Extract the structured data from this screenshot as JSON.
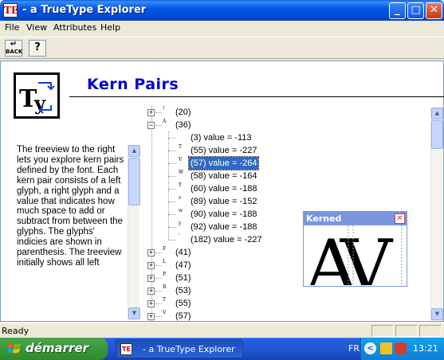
{
  "window": {
    "title": "- a TrueType Explorer",
    "icon_text": "TE",
    "minimize_label": "_",
    "maximize_label": "□",
    "close_label": "✕"
  },
  "menu": [
    "File",
    "View",
    "Attributes",
    "Help"
  ],
  "toolbar": {
    "back_label": "BACK",
    "help_label": "?"
  },
  "content": {
    "page_title": "Kern Pairs",
    "description": "The treeview to the right lets you explore kern pairs defined by the font. Each kern pair consists of a left glyph, a right glyph and a value that indicates how much space to add or subtract from between the glyphs. The glyphs' indicies are shown in parenthesis. The treeview initially shows all left"
  },
  "tree": {
    "collapsed_top": {
      "glyph": "!",
      "label": "(20)"
    },
    "expanded": {
      "glyph": "A",
      "label": "(36)"
    },
    "children": [
      {
        "glyph": "",
        "label": "(3) value = -113",
        "selected": false
      },
      {
        "glyph": "T",
        "label": "(55) value = -227",
        "selected": false
      },
      {
        "glyph": "V",
        "label": "(57) value = -264",
        "selected": true
      },
      {
        "glyph": "W",
        "label": "(58) value = -164",
        "selected": false
      },
      {
        "glyph": "Y",
        "label": "(60) value = -188",
        "selected": false
      },
      {
        "glyph": "v",
        "label": "(89) value = -152",
        "selected": false
      },
      {
        "glyph": "w",
        "label": "(90) value = -188",
        "selected": false
      },
      {
        "glyph": "y",
        "label": "(92) value = -188",
        "selected": false
      },
      {
        "glyph": "'",
        "label": "(182) value = -227",
        "selected": false
      }
    ],
    "collapsed_bottom": [
      {
        "glyph": "F",
        "label": "(41)"
      },
      {
        "glyph": "L",
        "label": "(47)"
      },
      {
        "glyph": "P",
        "label": "(51)"
      },
      {
        "glyph": "R",
        "label": "(53)"
      },
      {
        "glyph": "T",
        "label": "(55)"
      },
      {
        "glyph": "V",
        "label": "(57)"
      }
    ]
  },
  "kerned": {
    "title": "Kerned",
    "close_label": "✕",
    "left_glyph": "A",
    "right_glyph": "V"
  },
  "status": {
    "text": "Ready"
  },
  "taskbar": {
    "start_label": "démarrer",
    "task_label": "- a TrueType Explorer",
    "task_icon_text": "TE",
    "language": "FR",
    "clock": "13:21"
  },
  "colors": {
    "title_blue": "#0000cc",
    "selection": "#316ac5",
    "titlebar": "#0058e6",
    "start_green": "#3c9a3c"
  }
}
